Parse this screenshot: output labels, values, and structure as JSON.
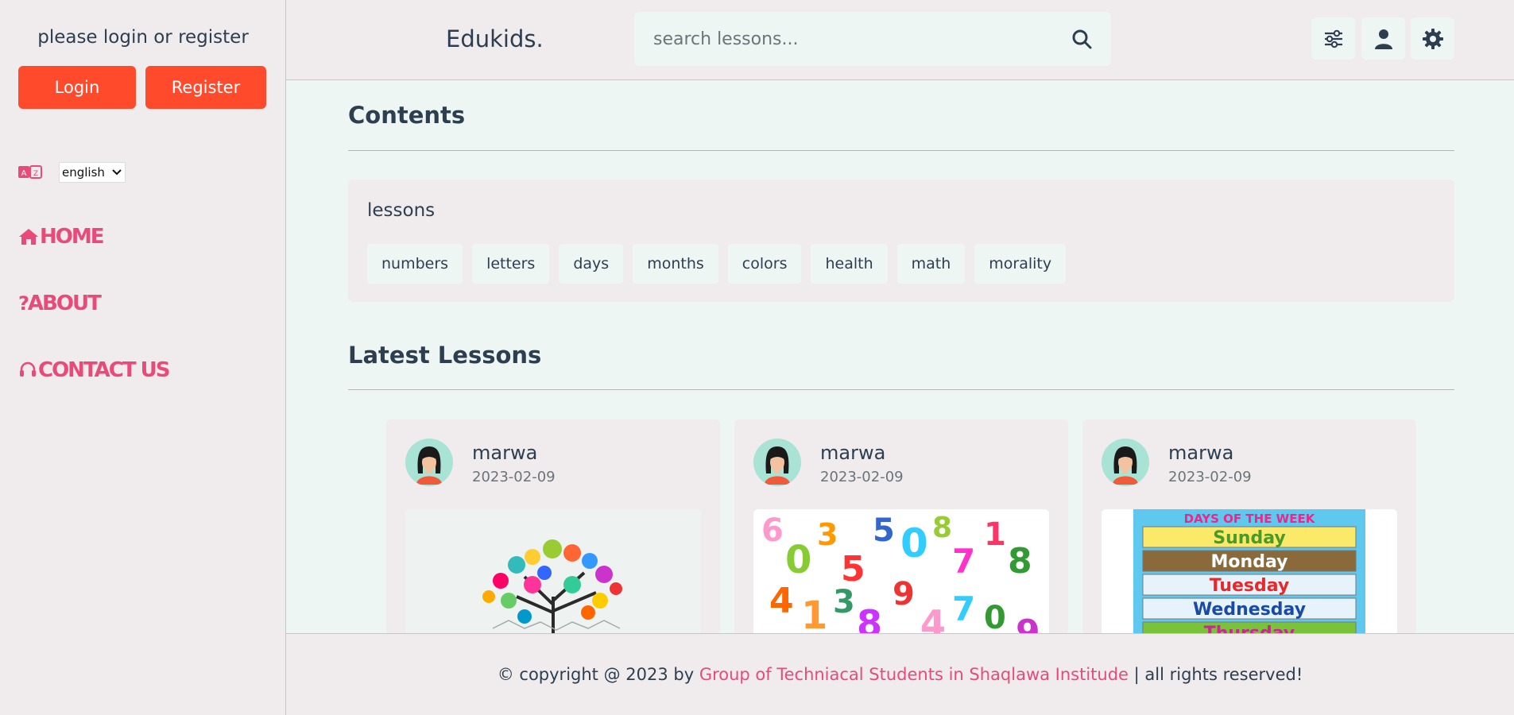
{
  "sidebar": {
    "prompt": "please login or register",
    "login_label": "Login",
    "register_label": "Register",
    "language": "english",
    "nav": [
      {
        "label": "HOME",
        "icon": "home-icon"
      },
      {
        "label": "ABOUT",
        "icon": "question-icon"
      },
      {
        "label": "CONTACT US",
        "icon": "headset-icon"
      }
    ]
  },
  "header": {
    "brand": "Edukids.",
    "search_placeholder": "search lessons...",
    "icons": [
      "filter-sliders-icon",
      "user-icon",
      "gear-icon"
    ]
  },
  "main": {
    "contents_title": "Contents",
    "lessons_heading": "lessons",
    "tags": [
      "numbers",
      "letters",
      "days",
      "months",
      "colors",
      "health",
      "math",
      "morality"
    ],
    "latest_title": "Latest Lessons",
    "cards": [
      {
        "author": "marwa",
        "date": "2023-02-09",
        "image": "letters-tree"
      },
      {
        "author": "marwa",
        "date": "2023-02-09",
        "image": "numbers"
      },
      {
        "author": "marwa",
        "date": "2023-02-09",
        "image": "days-of-week"
      }
    ]
  },
  "footer": {
    "prefix": "© copyright @ 2023 by ",
    "link": "Group of Techniacal Students in Shaqlawa Institude",
    "suffix": " | all rights reserved!"
  },
  "days_image": {
    "title": "DAYS OF THE WEEK",
    "days": [
      "Sunday",
      "Monday",
      "Tuesday",
      "Wednesday",
      "Thursday"
    ]
  },
  "colors": {
    "accent": "#ff4a2c",
    "link": "#e84a7a",
    "panel": "#f0ebec",
    "background": "#eef6f4"
  }
}
